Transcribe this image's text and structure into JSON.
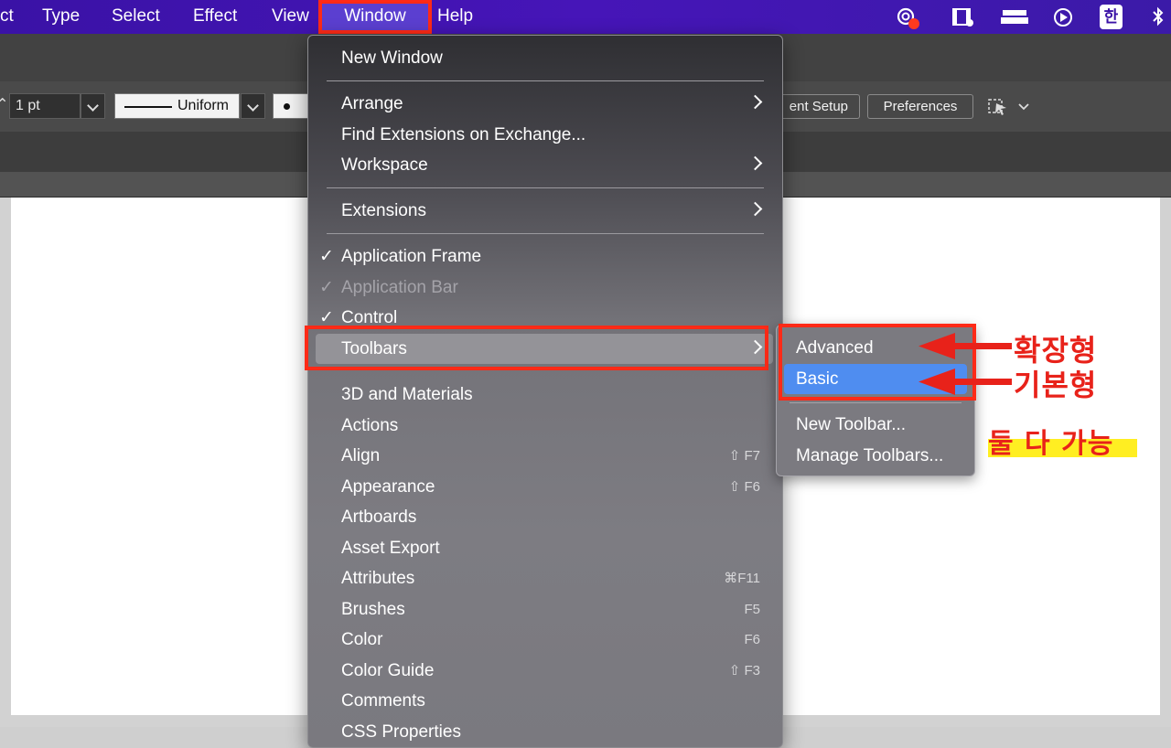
{
  "menubar": {
    "items": [
      {
        "label": "ct"
      },
      {
        "label": "Type"
      },
      {
        "label": "Select"
      },
      {
        "label": "Effect"
      },
      {
        "label": "View"
      },
      {
        "label": "Window"
      },
      {
        "label": "Help"
      }
    ],
    "tray": {
      "input_method": "한"
    }
  },
  "control_bar": {
    "stroke_weight": "1 pt",
    "stroke_profile": "Uniform",
    "document_setup": "ent Setup",
    "preferences": "Preferences"
  },
  "window_menu": {
    "items": [
      {
        "label": "New Window"
      },
      {
        "label": "Arrange"
      },
      {
        "label": "Find Extensions on Exchange..."
      },
      {
        "label": "Workspace"
      },
      {
        "label": "Extensions"
      },
      {
        "label": "Application Frame",
        "check": "✓"
      },
      {
        "label": "Application Bar",
        "check": "✓"
      },
      {
        "label": "Control",
        "check": "✓"
      },
      {
        "label": "Toolbars"
      },
      {
        "label": "3D and Materials"
      },
      {
        "label": "Actions"
      },
      {
        "label": "Align",
        "shortcut": "⇧ F7"
      },
      {
        "label": "Appearance",
        "shortcut": "⇧ F6"
      },
      {
        "label": "Artboards"
      },
      {
        "label": "Asset Export"
      },
      {
        "label": "Attributes",
        "shortcut": "⌘F11"
      },
      {
        "label": "Brushes",
        "shortcut": "F5"
      },
      {
        "label": "Color",
        "shortcut": "F6"
      },
      {
        "label": "Color Guide",
        "shortcut": "⇧ F3"
      },
      {
        "label": "Comments"
      },
      {
        "label": "CSS Properties"
      }
    ]
  },
  "toolbars_submenu": {
    "items": [
      {
        "label": "Advanced"
      },
      {
        "label": "Basic"
      },
      {
        "label": "New Toolbar..."
      },
      {
        "label": "Manage Toolbars..."
      }
    ]
  },
  "annotations": {
    "advanced_note": "확장형",
    "basic_note": "기본형",
    "both_note": "둘 다 가능"
  },
  "colors": {
    "menubar": "#3a12a6",
    "highlight_box": "#ff2a17",
    "selection": "#4f8df0",
    "annotation": "#e8221a"
  }
}
